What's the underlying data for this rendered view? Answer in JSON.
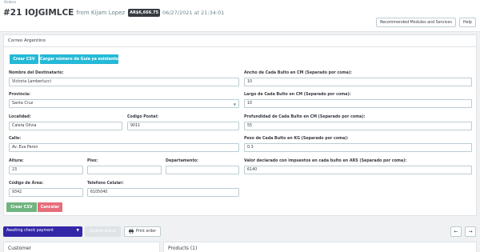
{
  "header": {
    "breadcrumb": "Orders",
    "order_id": "#21 IOJGIMLCE",
    "from_text": "from Kijam Lopez",
    "price": "AR$6,666.75",
    "date_text": "06/27/2021 at 21:34:01",
    "btn_modules": "Recommended Modules and Services",
    "btn_help": "Help"
  },
  "panel": {
    "title": "Correo Argentino",
    "btn_crear_csv": "Crear CSV",
    "btn_guia": "Cargar número de Guía ya existente",
    "fields": {
      "nombre": {
        "label": "Nombre del Destinatario:",
        "value": "Victoria Lamberlucci"
      },
      "provincia": {
        "label": "Provincia:",
        "value": "Santa Cruz"
      },
      "localidad": {
        "label": "Localidad:",
        "value": "Caleta Olivia"
      },
      "codigo_postal": {
        "label": "Codigo Postal:",
        "value": "9011"
      },
      "calle": {
        "label": "Calle:",
        "value": "Av. Eva Peron"
      },
      "altura": {
        "label": "Altura:",
        "value": "23"
      },
      "piso": {
        "label": "Piso:",
        "value": ""
      },
      "departamento": {
        "label": "Departamento:",
        "value": ""
      },
      "codigo_area": {
        "label": "Código de Área:",
        "value": "9342"
      },
      "telefono": {
        "label": "Telefono Celular:",
        "value": "6105040"
      },
      "ancho": {
        "label": "Ancho de Cada Bulto en CM (Separado por coma):",
        "value": "10"
      },
      "largo": {
        "label": "Largo de Cada Bulto en CM (Separado por coma):",
        "value": "10"
      },
      "profundidad": {
        "label": "Profundidad de Cada Bulto en CM (Separado por coma):",
        "value": "55"
      },
      "peso": {
        "label": "Peso de Cada Bulto en KG (Separado por coma):",
        "value": "0.3"
      },
      "valor": {
        "label": "Valor declarado con impuestos en cada bulto en ARS (Separado por coma):",
        "value": "6140"
      }
    },
    "btn_crear_csv_bottom": "Crear CSV",
    "btn_cancelar": "Cancelar"
  },
  "status": {
    "selected": "Awaiting check payment",
    "btn_update": "Update status",
    "btn_print": "Print order"
  },
  "cards": {
    "customer": "Customer",
    "products": "Products (1)"
  },
  "colors": {
    "accent": "#25b9d7",
    "success": "#70b580",
    "danger": "#e76d7a",
    "status": "#3327a8"
  }
}
